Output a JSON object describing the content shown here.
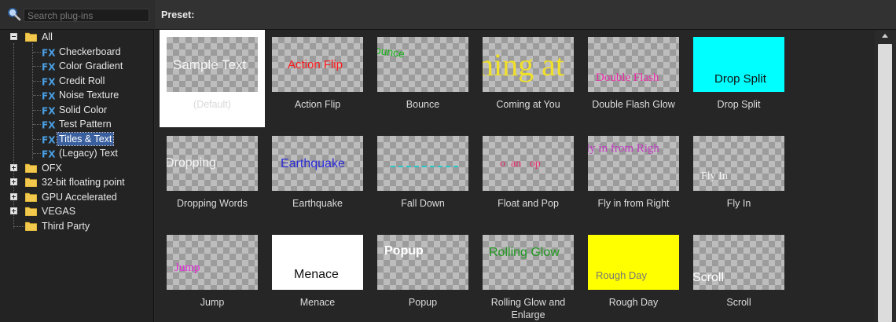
{
  "search": {
    "placeholder": "Search plug-ins",
    "value": ""
  },
  "tree": [
    {
      "label": "All",
      "type": "folder",
      "expander": "minus"
    },
    {
      "label": "Checkerboard",
      "type": "fx"
    },
    {
      "label": "Color Gradient",
      "type": "fx"
    },
    {
      "label": "Credit Roll",
      "type": "fx"
    },
    {
      "label": "Noise Texture",
      "type": "fx"
    },
    {
      "label": "Solid Color",
      "type": "fx"
    },
    {
      "label": "Test Pattern",
      "type": "fx"
    },
    {
      "label": "Titles & Text",
      "type": "fx",
      "selected": true
    },
    {
      "label": "(Legacy) Text",
      "type": "fx"
    },
    {
      "label": "OFX",
      "type": "folder",
      "expander": "plus"
    },
    {
      "label": "32-bit floating point",
      "type": "folder",
      "expander": "plus"
    },
    {
      "label": "GPU Accelerated",
      "type": "folder",
      "expander": "plus"
    },
    {
      "label": "VEGAS",
      "type": "folder",
      "expander": "plus"
    },
    {
      "label": "Third Party",
      "type": "folder"
    }
  ],
  "preset_header": {
    "label": "Preset:"
  },
  "presets": [
    {
      "label": "(Default)",
      "thumb_text": "Sample Text",
      "selected": true
    },
    {
      "label": "Action Flip",
      "thumb_text": "Action Flip"
    },
    {
      "label": "Bounce",
      "thumb_text": "ounce"
    },
    {
      "label": "Coming at You",
      "thumb_text": "ning at"
    },
    {
      "label": "Double Flash Glow",
      "thumb_text": "Double Flash"
    },
    {
      "label": "Drop Split",
      "thumb_text": "Drop Split"
    },
    {
      "label": "Dropping Words",
      "thumb_text": "Dropping"
    },
    {
      "label": "Earthquake",
      "thumb_text": "Earthquake"
    },
    {
      "label": "Fall Down",
      "thumb_text": ""
    },
    {
      "label": "Float and Pop",
      "thumb_text": "o  an   op"
    },
    {
      "label": "Fly in from Right",
      "thumb_text": "ly in from Righ"
    },
    {
      "label": "Fly In",
      "thumb_text": "Fly In"
    },
    {
      "label": "Jump",
      "thumb_text": "Jump"
    },
    {
      "label": "Menace",
      "thumb_text": "Menace"
    },
    {
      "label": "Popup",
      "thumb_text": "Popup"
    },
    {
      "label": "Rolling Glow and Enlarge",
      "thumb_text": "Rolling Glow"
    },
    {
      "label": "Rough Day",
      "thumb_text": "Rough Day"
    },
    {
      "label": "Scroll",
      "thumb_text": "Scroll"
    }
  ],
  "colors": {
    "selection": "#3a5f9e",
    "fx_icon": "#4aa0e6",
    "folder": "#f2c94c",
    "cyan": "#00ffff",
    "yellow": "#ffff00"
  }
}
